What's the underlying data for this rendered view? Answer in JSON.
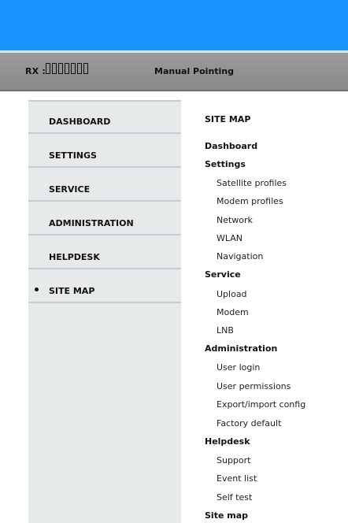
{
  "status_bar": {
    "rx_label": "RX :",
    "pointing_status": "Manual Pointing"
  },
  "nav": {
    "items": [
      {
        "label": "DASHBOARD",
        "selected": false
      },
      {
        "label": "SETTINGS",
        "selected": false
      },
      {
        "label": "SERVICE",
        "selected": false
      },
      {
        "label": "ADMINISTRATION",
        "selected": false
      },
      {
        "label": "HELPDESK",
        "selected": false
      },
      {
        "label": "SITE MAP",
        "selected": true
      }
    ]
  },
  "sitemap": {
    "title": "SITE MAP",
    "sections": [
      {
        "label": "Dashboard",
        "links": []
      },
      {
        "label": "Settings",
        "links": [
          "Satellite profiles",
          "Modem profiles",
          "Network",
          "WLAN",
          "Navigation"
        ]
      },
      {
        "label": "Service",
        "links": [
          "Upload",
          "Modem",
          "LNB"
        ]
      },
      {
        "label": "Administration",
        "links": [
          "User login",
          "User permissions",
          "Export/import config",
          "Factory default"
        ]
      },
      {
        "label": "Helpdesk",
        "links": [
          "Support",
          "Event list",
          "Self test"
        ]
      },
      {
        "label": "Site map",
        "links": []
      }
    ]
  },
  "colors": {
    "banner": "#1a94ff",
    "status_bar": "#8f8f8f",
    "nav_background": "#e6eaeb"
  }
}
